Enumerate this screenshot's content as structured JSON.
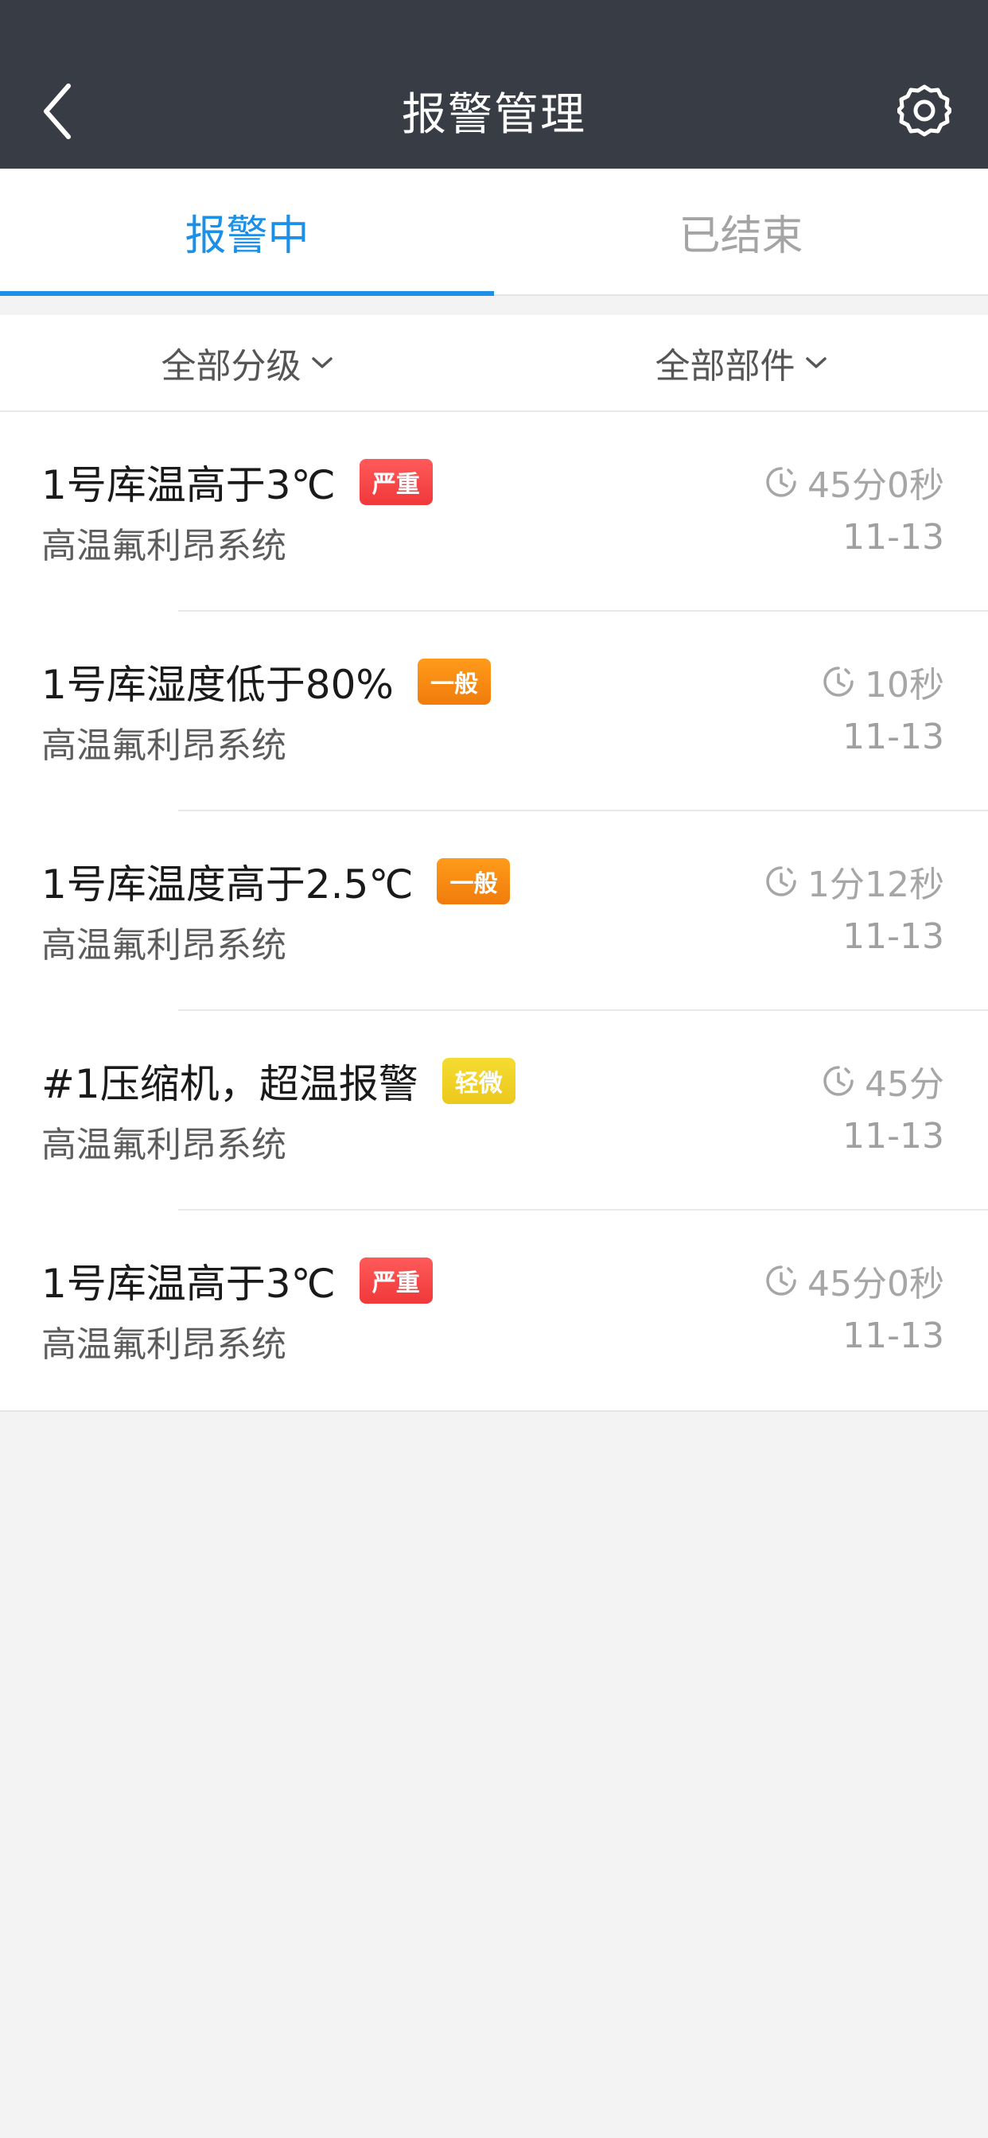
{
  "header": {
    "title": "报警管理"
  },
  "tabs": [
    {
      "label": "报警中",
      "active": true
    },
    {
      "label": "已结束",
      "active": false
    }
  ],
  "filters": {
    "level": "全部分级",
    "component": "全部部件"
  },
  "alarms": [
    {
      "title": "1号库温高于3℃",
      "badge": "严重",
      "level": "severe",
      "system": "高温氟利昂系统",
      "duration": "45分0秒",
      "date": "11-13"
    },
    {
      "title": "1号库湿度低于80%",
      "badge": "一般",
      "level": "general",
      "system": "高温氟利昂系统",
      "duration": "10秒",
      "date": "11-13"
    },
    {
      "title": "1号库温度高于2.5℃",
      "badge": "一般",
      "level": "general",
      "system": "高温氟利昂系统",
      "duration": "1分12秒",
      "date": "11-13"
    },
    {
      "title": "#1压缩机，超温报警",
      "badge": "轻微",
      "level": "minor",
      "system": "高温氟利昂系统",
      "duration": "45分",
      "date": "11-13"
    },
    {
      "title": "1号库温高于3℃",
      "badge": "严重",
      "level": "severe",
      "system": "高温氟利昂系统",
      "duration": "45分0秒",
      "date": "11-13"
    }
  ],
  "colors": {
    "header_bg": "#383c44",
    "accent": "#1c8fe6",
    "severe": "#f0383a",
    "general": "#f07c0b",
    "minor": "#ecc81c",
    "page_bg": "#f3f3f3"
  },
  "icons": {
    "back": "chevron-left-icon",
    "settings": "gear-icon",
    "filter_arrow": "chevron-down-icon",
    "duration": "timer-icon"
  }
}
